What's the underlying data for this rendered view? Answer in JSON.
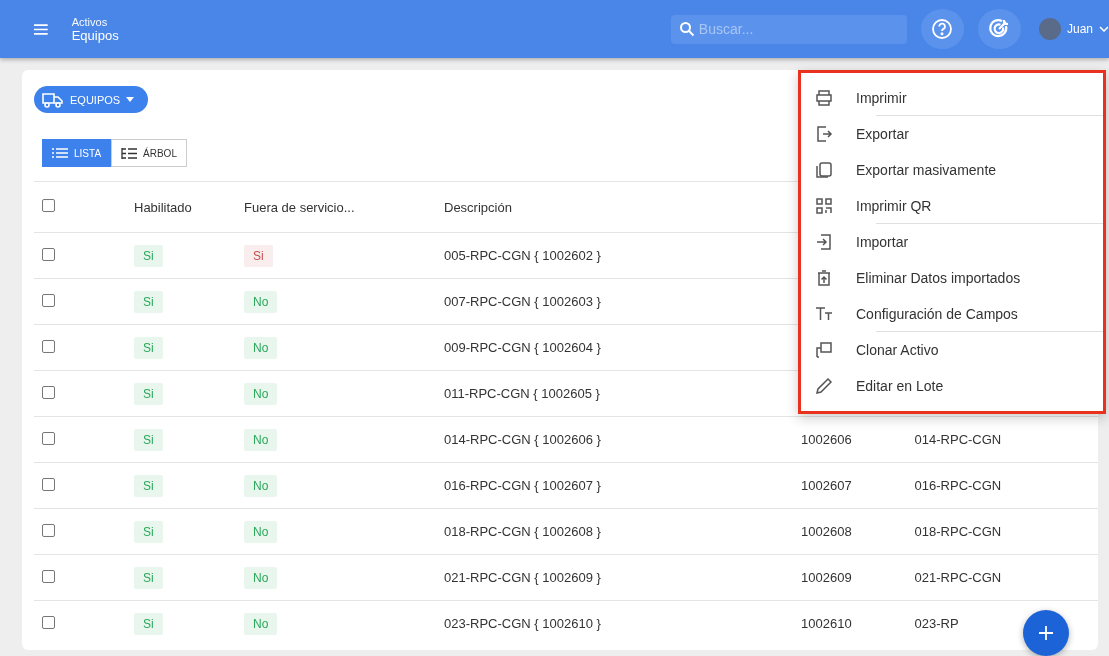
{
  "header": {
    "breadcrumb": "Activos",
    "title": "Equipos",
    "search": {
      "placeholder": "Buscar..."
    },
    "user": {
      "name": "Juan"
    }
  },
  "toolbar": {
    "entity_button": "EQUIPOS",
    "view_tabs": [
      {
        "label": "LISTA",
        "selected": true
      },
      {
        "label": "ÁRBOL",
        "selected": false
      }
    ]
  },
  "table": {
    "columns": [
      "Habilitado",
      "Fuera de servicio...",
      "Descripción"
    ],
    "select_all_checked": false,
    "rows": [
      {
        "checked": false,
        "enabled": {
          "text": "Si",
          "color": "#2aa85a"
        },
        "out_of_service": {
          "text": "Si",
          "color": "#c0504d"
        },
        "description": "005-RPC-CGN { 1002602 }"
      },
      {
        "checked": false,
        "enabled": {
          "text": "Si",
          "color": "#2aa85a"
        },
        "out_of_service": {
          "text": "No",
          "color": "#2aa85a"
        },
        "description": "007-RPC-CGN { 1002603 }"
      },
      {
        "checked": false,
        "enabled": {
          "text": "Si",
          "color": "#2aa85a"
        },
        "out_of_service": {
          "text": "No",
          "color": "#2aa85a"
        },
        "description": "009-RPC-CGN { 1002604 }"
      },
      {
        "checked": false,
        "enabled": {
          "text": "Si",
          "color": "#2aa85a"
        },
        "out_of_service": {
          "text": "No",
          "color": "#2aa85a"
        },
        "description": "011-RPC-CGN { 1002605 }"
      },
      {
        "checked": false,
        "enabled": {
          "text": "Si",
          "color": "#2aa85a"
        },
        "out_of_service": {
          "text": "No",
          "color": "#2aa85a"
        },
        "description": "014-RPC-CGN { 1002606 }",
        "column_4": "1002606",
        "column_5": "014-RPC-CGN"
      },
      {
        "checked": false,
        "enabled": {
          "text": "Si",
          "color": "#2aa85a"
        },
        "out_of_service": {
          "text": "No",
          "color": "#2aa85a"
        },
        "description": "016-RPC-CGN { 1002607 }",
        "column_4": "1002607",
        "column_5": "016-RPC-CGN"
      },
      {
        "checked": false,
        "enabled": {
          "text": "Si",
          "color": "#2aa85a"
        },
        "out_of_service": {
          "text": "No",
          "color": "#2aa85a"
        },
        "description": "018-RPC-CGN { 1002608 }",
        "column_4": "1002608",
        "column_5": "018-RPC-CGN"
      },
      {
        "checked": false,
        "enabled": {
          "text": "Si",
          "color": "#2aa85a"
        },
        "out_of_service": {
          "text": "No",
          "color": "#2aa85a"
        },
        "description": "021-RPC-CGN { 1002609 }",
        "column_4": "1002609",
        "column_5": "021-RPC-CGN"
      },
      {
        "checked": false,
        "enabled": {
          "text": "Si",
          "color": "#2aa85a"
        },
        "out_of_service": {
          "text": "No",
          "color": "#2aa85a"
        },
        "description": "023-RPC-CGN { 1002610 }",
        "column_4": "1002610",
        "column_5": "023-RP"
      }
    ]
  },
  "menu": {
    "highlighted": true,
    "items": [
      {
        "kind": "print",
        "label": "Imprimir",
        "divider_after": true
      },
      {
        "kind": "export",
        "label": "Exportar",
        "divider_after": false
      },
      {
        "kind": "bulk-export",
        "label": "Exportar masivamente",
        "divider_after": false
      },
      {
        "kind": "qr",
        "label": "Imprimir QR",
        "divider_after": true
      },
      {
        "kind": "import",
        "label": "Importar",
        "divider_after": false
      },
      {
        "kind": "delete-import",
        "label": "Eliminar Datos importados",
        "divider_after": false
      },
      {
        "kind": "fields",
        "label": "Configuración de Campos",
        "divider_after": true
      },
      {
        "kind": "clone",
        "label": "Clonar Activo",
        "divider_after": false
      },
      {
        "kind": "edit",
        "label": "Editar en Lote",
        "divider_after": false
      }
    ]
  }
}
